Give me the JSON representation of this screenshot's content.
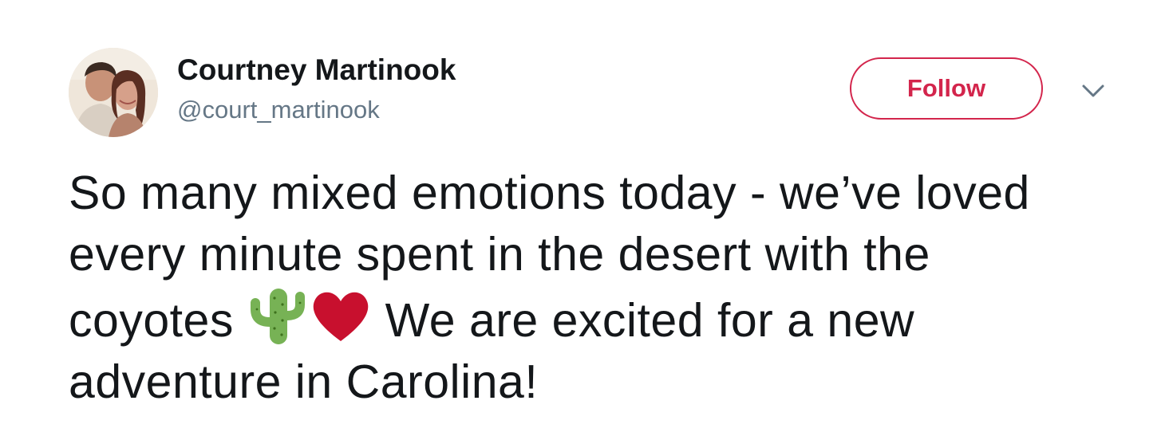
{
  "author": {
    "display_name": "Courtney Martinook",
    "handle": "@court_martinook",
    "avatar_icon": "profile-photo"
  },
  "actions": {
    "follow_label": "Follow",
    "more_icon": "chevron-down-icon",
    "follow_color": "#d3254c"
  },
  "tweet": {
    "line1": "So many mixed emotions today - we’ve loved",
    "line2": "every minute spent in the desert with the",
    "line3_before": "coyotes ",
    "emoji_1": "cactus-emoji",
    "emoji_2": "red-heart-emoji",
    "line3_after": " We are excited for a new",
    "line4": "adventure in Carolina!"
  }
}
